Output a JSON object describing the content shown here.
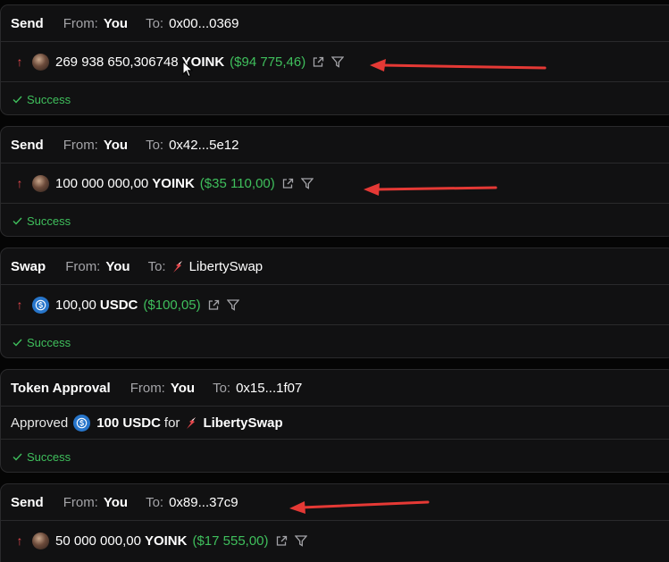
{
  "transactions": [
    {
      "type": "Send",
      "from_label": "From:",
      "from_value": "You",
      "to_label": "To:",
      "to_value": "0x00...0369",
      "direction_icon": "arrow-up-icon",
      "token_icon": "yoink-avatar",
      "amount": "269 938 650,306748",
      "symbol": "YOINK",
      "usd": "($94 775,46)",
      "status": "Success"
    },
    {
      "type": "Send",
      "from_label": "From:",
      "from_value": "You",
      "to_label": "To:",
      "to_value": "0x42...5e12",
      "direction_icon": "arrow-up-icon",
      "token_icon": "yoink-avatar",
      "amount": "100 000 000,00",
      "symbol": "YOINK",
      "usd": "($35 110,00)",
      "status": "Success"
    },
    {
      "type": "Swap",
      "from_label": "From:",
      "from_value": "You",
      "to_label": "To:",
      "to_value": "LibertySwap",
      "direction_icon": "arrow-up-icon",
      "token_icon": "usdc-icon",
      "amount": "100,00",
      "symbol": "USDC",
      "usd": "($100,05)",
      "status": "Success"
    },
    {
      "type": "Token Approval",
      "from_label": "From:",
      "from_value": "You",
      "to_label": "To:",
      "to_value": "0x15...1f07",
      "approved_word": "Approved",
      "approved_amount": "100 USDC",
      "for_word": "for",
      "spender": "LibertySwap",
      "status": "Success"
    },
    {
      "type": "Send",
      "from_label": "From:",
      "from_value": "You",
      "to_label": "To:",
      "to_value": "0x89...37c9",
      "direction_icon": "arrow-up-icon",
      "token_icon": "yoink-avatar",
      "amount": "50 000 000,00",
      "symbol": "YOINK",
      "usd": "($17 555,00)"
    }
  ],
  "colors": {
    "success": "#3fbf5c",
    "sent_arrow": "#e5484d",
    "annotation_arrow": "#e53935",
    "usdc": "#2775ca"
  },
  "icons": [
    "external-link-icon",
    "filter-icon",
    "check-icon",
    "libertyswap-logo",
    "cursor-icon"
  ]
}
